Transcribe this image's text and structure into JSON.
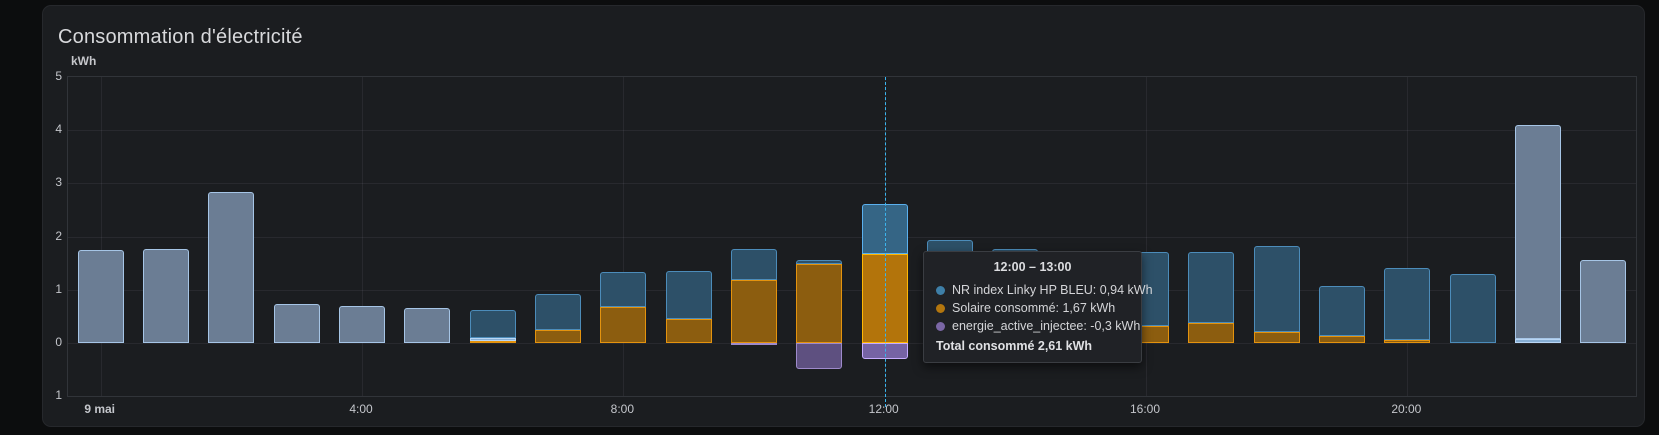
{
  "panel": {
    "title": "Consommation d'électricité"
  },
  "tooltip": {
    "header": "12:00 – 13:00",
    "rows": [
      {
        "label": "NR index Linky HP BLEU: 0,94 kWh",
        "color": "#3e7fa7"
      },
      {
        "label": "Solaire consommé: 1,67 kWh",
        "color": "#b3760e"
      },
      {
        "label": "energie_active_injectee: -0,3 kWh",
        "color": "#7b67a6"
      }
    ],
    "total": "Total consommé 2,61 kWh"
  },
  "chart_data": {
    "type": "bar",
    "stacked": true,
    "title": "Consommation d'électricité",
    "ylabel": "kWh",
    "ylim": [
      -1,
      5
    ],
    "grid": true,
    "y_ticks": [
      {
        "value": 5,
        "label": "5"
      },
      {
        "value": 4,
        "label": "4"
      },
      {
        "value": 3,
        "label": "3"
      },
      {
        "value": 2,
        "label": "2"
      },
      {
        "value": 1,
        "label": "1"
      },
      {
        "value": 0,
        "label": "0"
      },
      {
        "value": -1,
        "label": "1"
      }
    ],
    "x_ticks": [
      {
        "hour": 0,
        "label": "9 mai",
        "bold": true
      },
      {
        "hour": 4,
        "label": "4:00"
      },
      {
        "hour": 8,
        "label": "8:00"
      },
      {
        "hour": 12,
        "label": "12:00"
      },
      {
        "hour": 16,
        "label": "16:00"
      },
      {
        "hour": 20,
        "label": "20:00"
      }
    ],
    "series_styles": {
      "light": {
        "fill": "#6b7d94",
        "stroke": "#a6c5e6"
      },
      "light-bright": {
        "fill": "#86aed4",
        "stroke": "#b9d6f4"
      },
      "hp": {
        "fill": "#2d5068",
        "stroke": "#4c8cba",
        "name": "NR index Linky HP BLEU"
      },
      "solar": {
        "fill": "#8c5d0f",
        "stroke": "#e4930e",
        "name": "Solaire consommé"
      },
      "inj": {
        "fill": "#5e5080",
        "stroke": "#9e8acb",
        "name": "energie_active_injectee"
      }
    },
    "crosshair_hour": 12,
    "bars": [
      {
        "hour": 0,
        "segments": [
          [
            "light",
            1.74
          ]
        ]
      },
      {
        "hour": 1,
        "segments": [
          [
            "light",
            1.77
          ]
        ]
      },
      {
        "hour": 2,
        "segments": [
          [
            "light",
            2.84
          ]
        ]
      },
      {
        "hour": 3,
        "segments": [
          [
            "light",
            0.74
          ]
        ]
      },
      {
        "hour": 4,
        "segments": [
          [
            "light",
            0.7
          ]
        ]
      },
      {
        "hour": 5,
        "segments": [
          [
            "light",
            0.66
          ]
        ]
      },
      {
        "hour": 6,
        "segments": [
          [
            "solar",
            0.03
          ],
          [
            "light-bright",
            0.07
          ],
          [
            "hp",
            0.52
          ]
        ]
      },
      {
        "hour": 7,
        "segments": [
          [
            "solar",
            0.25
          ],
          [
            "hp",
            0.67
          ]
        ]
      },
      {
        "hour": 8,
        "segments": [
          [
            "solar",
            0.68
          ],
          [
            "hp",
            0.66
          ]
        ]
      },
      {
        "hour": 9,
        "segments": [
          [
            "solar",
            0.45
          ],
          [
            "hp",
            0.91
          ]
        ]
      },
      {
        "hour": 10,
        "segments": [
          [
            "solar",
            1.19
          ],
          [
            "hp",
            0.58
          ],
          [
            "inj",
            -0.05
          ]
        ]
      },
      {
        "hour": 11,
        "segments": [
          [
            "solar",
            1.49
          ],
          [
            "hp",
            0.06
          ],
          [
            "inj",
            -0.5
          ]
        ]
      },
      {
        "hour": 12,
        "segments": [
          [
            "solar",
            1.67
          ],
          [
            "hp",
            0.94
          ],
          [
            "inj",
            -0.3
          ]
        ],
        "highlight": true
      },
      {
        "hour": 13,
        "segments": [
          [
            "solar",
            0.55
          ],
          [
            "hp",
            1.38
          ]
        ]
      },
      {
        "hour": 14,
        "segments": [
          [
            "solar",
            0.45
          ],
          [
            "hp",
            1.32
          ]
        ]
      },
      {
        "hour": 15,
        "segments": [
          [
            "solar",
            0.4
          ],
          [
            "hp",
            1.25
          ]
        ]
      },
      {
        "hour": 16,
        "segments": [
          [
            "solar",
            0.32
          ],
          [
            "hp",
            1.38
          ]
        ]
      },
      {
        "hour": 17,
        "segments": [
          [
            "solar",
            0.38
          ],
          [
            "hp",
            1.33
          ]
        ]
      },
      {
        "hour": 18,
        "segments": [
          [
            "solar",
            0.21
          ],
          [
            "hp",
            1.62
          ]
        ]
      },
      {
        "hour": 19,
        "segments": [
          [
            "solar",
            0.13
          ],
          [
            "hp",
            0.94
          ]
        ]
      },
      {
        "hour": 20,
        "segments": [
          [
            "solar",
            0.05
          ],
          [
            "hp",
            1.35
          ]
        ]
      },
      {
        "hour": 21,
        "segments": [
          [
            "hp",
            1.29
          ]
        ]
      },
      {
        "hour": 22,
        "segments": [
          [
            "light-bright",
            0.08
          ],
          [
            "light",
            4.01
          ]
        ]
      },
      {
        "hour": 23,
        "segments": [
          [
            "light",
            1.55
          ]
        ]
      }
    ]
  }
}
